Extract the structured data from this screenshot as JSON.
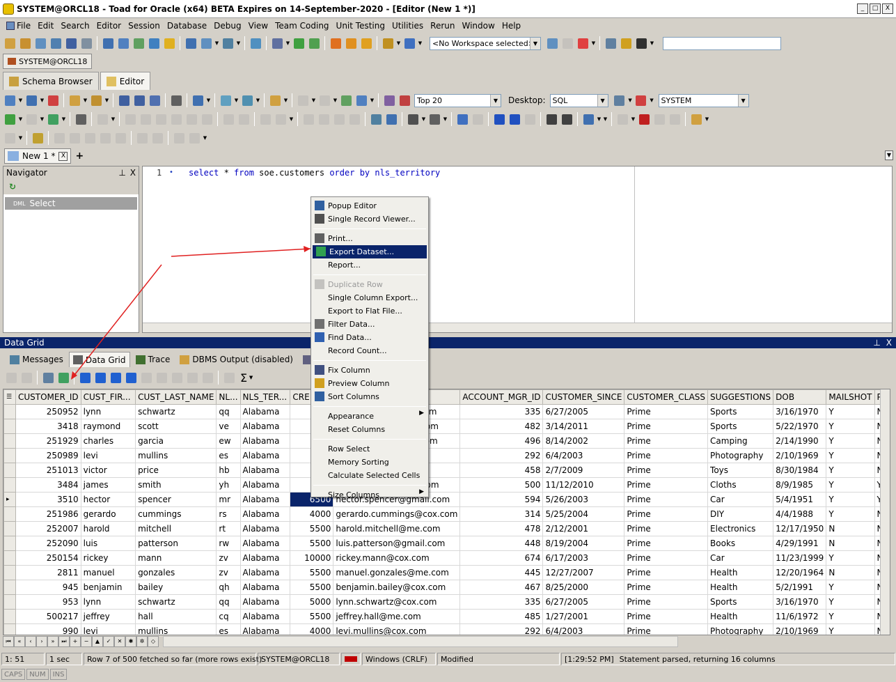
{
  "window": {
    "title": "SYSTEM@ORCL18 - Toad for Oracle (x64)  BETA Expires on 14-September-2020 - [Editor (New 1 *)]",
    "min": "_",
    "max": "□",
    "close": "X"
  },
  "menu": [
    "File",
    "Edit",
    "Search",
    "Editor",
    "Session",
    "Database",
    "Debug",
    "View",
    "Team Coding",
    "Unit Testing",
    "Utilities",
    "Rerun",
    "Window",
    "Help"
  ],
  "workspace": {
    "value": "<No Workspace selected>"
  },
  "session": {
    "label": "SYSTEM@ORCL18"
  },
  "main_tabs": [
    {
      "label": "Schema Browser"
    },
    {
      "label": "Editor"
    }
  ],
  "editor_toolbar": {
    "top_rows": "Top 20",
    "desktop_label": "Desktop:",
    "desktop_value": "SQL",
    "schema_value": "SYSTEM"
  },
  "editor_tab": {
    "label": "New 1 *",
    "close": "X",
    "add": "+"
  },
  "navigator": {
    "title": "Navigator",
    "pin": "⊥",
    "close": "X",
    "item_tag": "DML",
    "item": "Select"
  },
  "editor": {
    "line_no": "1",
    "code_parts": [
      "select",
      " * ",
      "from",
      " soe.customers ",
      "order",
      " ",
      "by",
      " nls_territory"
    ]
  },
  "datagrid": {
    "title": "Data Grid",
    "tabs": [
      "Messages",
      "Data Grid",
      "Trace",
      "DBMS Output (disabled)",
      "Query Viewer",
      "Output"
    ],
    "columns": [
      "CUSTOMER_ID",
      "CUST_FIR...",
      "CUST_LAST_NAME",
      "NL...",
      "NLS_TER...",
      "CRE",
      "",
      "ACCOUNT_MGR_ID",
      "CUSTOMER_SINCE",
      "CUSTOMER_CLASS",
      "SUGGESTIONS",
      "DOB",
      "MAILSHOT",
      "P"
    ],
    "rows": [
      [
        "250952",
        "lynn",
        "schwartz",
        "qq",
        "Alabama",
        "",
        "lynn.schwartz@cox.com",
        "335",
        "6/27/2005",
        "Prime",
        "Sports",
        "3/16/1970",
        "Y",
        "N"
      ],
      [
        "3418",
        "raymond",
        "scott",
        "ve",
        "Alabama",
        "",
        "raymond.scott@me.com",
        "482",
        "3/14/2011",
        "Prime",
        "Sports",
        "5/22/1970",
        "Y",
        "N"
      ],
      [
        "251929",
        "charles",
        "garcia",
        "ew",
        "Alabama",
        "",
        "charles.garcia@cox.com",
        "496",
        "8/14/2002",
        "Prime",
        "Camping",
        "2/14/1990",
        "Y",
        "N"
      ],
      [
        "250989",
        "levi",
        "mullins",
        "es",
        "Alabama",
        "",
        "levi.mullins@cox.com",
        "292",
        "6/4/2003",
        "Prime",
        "Photography",
        "2/10/1969",
        "Y",
        "N"
      ],
      [
        "251013",
        "victor",
        "price",
        "hb",
        "Alabama",
        "",
        "victor.price@cox.com",
        "458",
        "2/7/2009",
        "Prime",
        "Toys",
        "8/30/1984",
        "Y",
        "N"
      ],
      [
        "3484",
        "james",
        "smith",
        "yh",
        "Alabama",
        "",
        "james.smith@gmail.com",
        "500",
        "11/12/2010",
        "Prime",
        "Cloths",
        "8/9/1985",
        "Y",
        "Y"
      ],
      [
        "3510",
        "hector",
        "spencer",
        "mr",
        "Alabama",
        "6500",
        "hector.spencer@gmail.com",
        "594",
        "5/26/2003",
        "Prime",
        "Car",
        "5/4/1951",
        "Y",
        "Y"
      ],
      [
        "251986",
        "gerardo",
        "cummings",
        "rs",
        "Alabama",
        "4000",
        "gerardo.cummings@cox.com",
        "314",
        "5/25/2004",
        "Prime",
        "DIY",
        "4/4/1988",
        "Y",
        "N"
      ],
      [
        "252007",
        "harold",
        "mitchell",
        "rt",
        "Alabama",
        "5500",
        "harold.mitchell@me.com",
        "478",
        "2/12/2001",
        "Prime",
        "Electronics",
        "12/17/1950",
        "N",
        "N"
      ],
      [
        "252090",
        "luis",
        "patterson",
        "rw",
        "Alabama",
        "5500",
        "luis.patterson@gmail.com",
        "448",
        "8/19/2004",
        "Prime",
        "Books",
        "4/29/1991",
        "N",
        "N"
      ],
      [
        "250154",
        "rickey",
        "mann",
        "zv",
        "Alabama",
        "10000",
        "rickey.mann@cox.com",
        "674",
        "6/17/2003",
        "Prime",
        "Car",
        "11/23/1999",
        "Y",
        "N"
      ],
      [
        "2811",
        "manuel",
        "gonzales",
        "zv",
        "Alabama",
        "5500",
        "manuel.gonzales@me.com",
        "445",
        "12/27/2007",
        "Prime",
        "Health",
        "12/20/1964",
        "N",
        "N"
      ],
      [
        "945",
        "benjamin",
        "bailey",
        "qh",
        "Alabama",
        "5500",
        "benjamin.bailey@cox.com",
        "467",
        "8/25/2000",
        "Prime",
        "Health",
        "5/2/1991",
        "Y",
        "N"
      ],
      [
        "953",
        "lynn",
        "schwartz",
        "qq",
        "Alabama",
        "5000",
        "lynn.schwartz@cox.com",
        "335",
        "6/27/2005",
        "Prime",
        "Sports",
        "3/16/1970",
        "Y",
        "N"
      ],
      [
        "500217",
        "jeffrey",
        "hall",
        "cq",
        "Alabama",
        "5500",
        "jeffrey.hall@me.com",
        "485",
        "1/27/2001",
        "Prime",
        "Health",
        "11/6/1972",
        "Y",
        "N"
      ],
      [
        "990",
        "levi",
        "mullins",
        "es",
        "Alabama",
        "4000",
        "levi.mullins@cox.com",
        "292",
        "6/4/2003",
        "Prime",
        "Photography",
        "2/10/1969",
        "Y",
        "N"
      ]
    ]
  },
  "context_menu": {
    "groups": [
      [
        {
          "label": "Popup Editor",
          "icon": "popup-editor-icon"
        },
        {
          "label": "Single Record Viewer...",
          "icon": "record-viewer-icon"
        }
      ],
      [
        {
          "label": "Print...",
          "icon": "printer-icon"
        },
        {
          "label": "Export Dataset...",
          "icon": "export-dataset-icon",
          "highlight": true
        },
        {
          "label": "Report...",
          "icon": ""
        }
      ],
      [
        {
          "label": "Duplicate Row",
          "icon": "duplicate-row-icon",
          "disabled": true
        },
        {
          "label": "Single Column Export...",
          "icon": ""
        },
        {
          "label": "Export to Flat File...",
          "icon": ""
        },
        {
          "label": "Filter Data...",
          "icon": "filter-icon"
        },
        {
          "label": "Find Data...",
          "icon": "find-icon"
        },
        {
          "label": "Record Count...",
          "icon": ""
        }
      ],
      [
        {
          "label": "Fix Column",
          "icon": "fix-column-icon"
        },
        {
          "label": "Preview Column",
          "icon": "preview-column-icon"
        },
        {
          "label": "Sort Columns",
          "icon": "sort-columns-icon"
        }
      ],
      [
        {
          "label": "Appearance",
          "icon": "",
          "submenu": true
        },
        {
          "label": "Reset Columns",
          "icon": ""
        }
      ],
      [
        {
          "label": "Row Select",
          "icon": ""
        },
        {
          "label": "Memory Sorting",
          "icon": ""
        },
        {
          "label": "Calculate Selected Cells",
          "icon": ""
        }
      ],
      [
        {
          "label": "Size Columns",
          "icon": "",
          "submenu": true
        }
      ]
    ]
  },
  "status": {
    "position": "1:  51",
    "time": "1 sec",
    "rows": "Row 7 of 500 fetched so far (more rows exist)",
    "conn": "SYSTEM@ORCL18",
    "eol": "Windows (CRLF)",
    "state": "Modified",
    "msg_time": "[1:29:52 PM]",
    "msg": "Statement parsed, returning 16 columns",
    "caps": "CAPS",
    "num": "NUM",
    "ins": "INS"
  },
  "colors": {
    "accent": "#0a246a",
    "annotation": "#e02020"
  }
}
